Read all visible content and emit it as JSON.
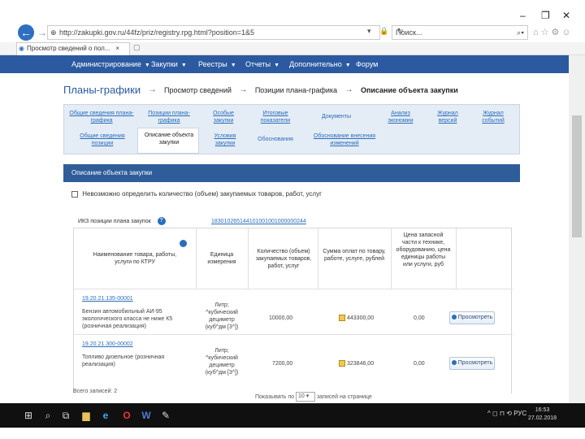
{
  "window": {
    "controls": [
      "–",
      "❐",
      "✕"
    ]
  },
  "address": {
    "url": "http://zakupki.gov.ru/44fz/priz/registry.rpg.html?position=1&5",
    "tools": "▾ 🔒 ↻",
    "search_placeholder": "Поиск..."
  },
  "tab": {
    "title": "Просмотр сведений о пол...",
    "close": "×"
  },
  "mainnav": {
    "items": [
      {
        "label": "Администрирование"
      },
      {
        "label": "Закупки"
      },
      {
        "label": "Реестры"
      },
      {
        "label": "Отчеты"
      },
      {
        "label": "Дополнительно"
      },
      {
        "label": "Форум"
      }
    ]
  },
  "breadcrumb": {
    "root": "Планы-графики",
    "items": [
      "Просмотр сведений",
      "Позиции плана-графика",
      "Описание объекта закупки"
    ],
    "sep": "→"
  },
  "subnav": {
    "row1": [
      "Общие сведения плана-графика",
      "Позиции плана-графика",
      "Особые закупки",
      "Итоговые показатели",
      "Документы",
      "Анализ экономии",
      "Журнал версий",
      "Журнал событий"
    ],
    "row2": [
      "Общие сведения позиции",
      "Описание объекта закупки",
      "Условия закупки",
      "Обоснования",
      "Обоснование внесения изменений"
    ]
  },
  "section": {
    "title": "Описание объекта закупки",
    "checkbox_label": "Невозможно определить количество (объем) закупаемых товаров, работ, услуг"
  },
  "ikz": {
    "label": "ИКЗ позиции плана закупок",
    "help": "?",
    "value": "183010265144101001001000000244"
  },
  "table": {
    "headers": [
      "Наименование товара, работы, услуги по КТРУ",
      "Единица измерения",
      "Количество (объем) закупаемых товаров, работ, услуг",
      "Сумма оплат по товару, работе, услуге, рублей",
      "Цена запасной части к технике, оборудованию, цена единицы работы или услуги, руб"
    ],
    "rows": [
      {
        "code": "19.20.21.135-00001",
        "name": "Бензин автомобильный АИ-95 экологического класса не ниже К5 (розничная реализация)",
        "unit": "Литр; ^кубический дециметр (куб^дм [3^])",
        "qty": "10000,00",
        "sum": "443300,00",
        "price": "0,00",
        "action": "Просмотреть"
      },
      {
        "code": "19.20.21.300-00002",
        "name": "Топливо дизельное (розничная реализация)",
        "unit": "Литр; ^кубический дециметр (куб^дм [3^])",
        "qty": "7200,00",
        "sum": "323846,00",
        "price": "0,00",
        "action": "Просмотреть"
      }
    ]
  },
  "footer": {
    "total_label": "Всего записей: 2",
    "show_label": "Показывать по",
    "page_size": "10",
    "suffix": "записей на странице"
  },
  "taskbar": {
    "time": "16:53",
    "date": "27.02.2018",
    "lang": "РУС",
    "tray": "^ ◻ ⊓ ⟲"
  }
}
